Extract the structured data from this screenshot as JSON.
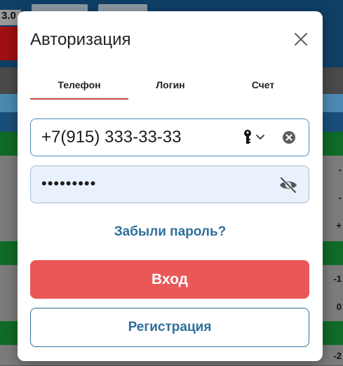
{
  "background": {
    "top_number": "3.0",
    "right_values": [
      "-",
      "-",
      "+",
      "-1",
      "0",
      "-2"
    ]
  },
  "modal": {
    "title": "Авторизация",
    "close_icon": "close-icon",
    "tabs": [
      {
        "label": "Телефон",
        "active": true
      },
      {
        "label": "Логин",
        "active": false
      },
      {
        "label": "Счет",
        "active": false
      }
    ],
    "phone_field": {
      "value": "+7(915) 333-33-33",
      "key_icon": "key-icon",
      "chevron_icon": "chevron-down-icon",
      "clear_icon": "clear-circle-icon"
    },
    "password_field": {
      "value": "•••••••••",
      "visibility_icon": "eye-off-icon"
    },
    "forgot_password": "Забыли пароль?",
    "login_button": "Вход",
    "register_button": "Регистрация",
    "colors": {
      "accent_red": "#e95757",
      "link_blue": "#2f6f9a",
      "tab_underline": "#c9453f",
      "password_bg": "#e9f1fd"
    }
  }
}
